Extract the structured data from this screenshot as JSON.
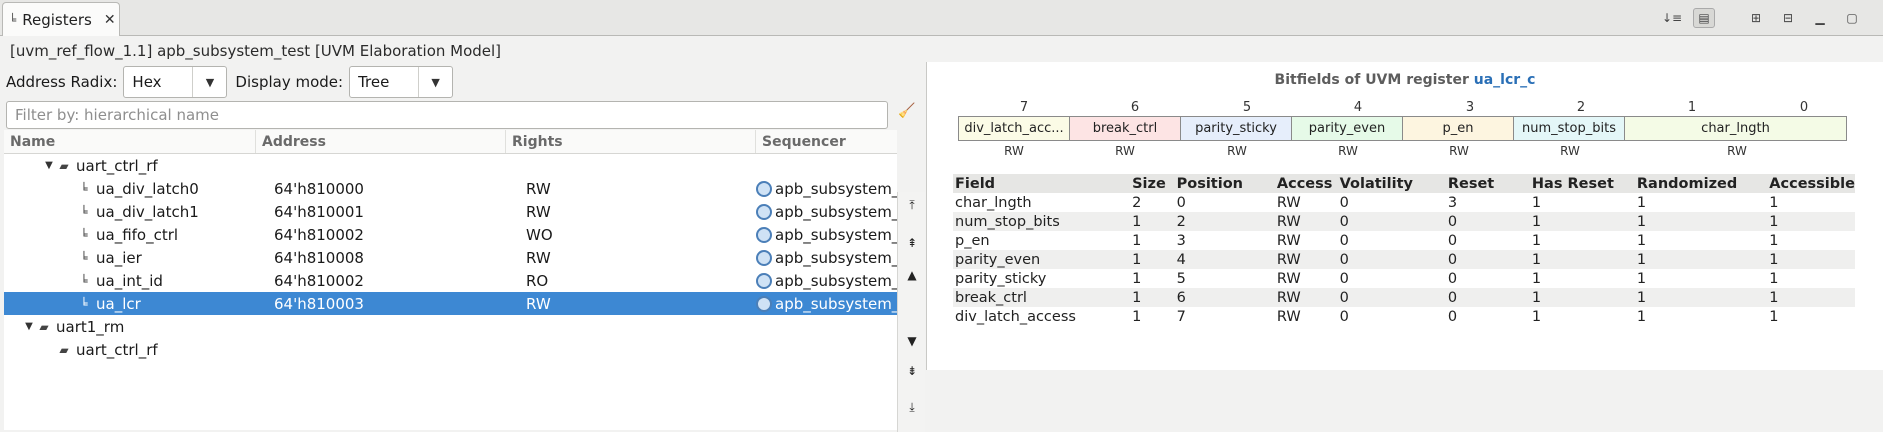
{
  "tab": {
    "title": "Registers",
    "close": "✕"
  },
  "model_line": "[uvm_ref_flow_1.1] apb_subsystem_test [UVM Elaboration Model]",
  "controls": {
    "radix_label": "Address Radix:",
    "radix_value": "Hex",
    "display_label": "Display mode:",
    "display_value": "Tree",
    "filter_placeholder": "Filter by: hierarchical name"
  },
  "columns": [
    "Name",
    "Address",
    "Rights",
    "Sequencer"
  ],
  "rows": [
    {
      "name": "uart_ctrl_rf",
      "address": "",
      "rights": "",
      "sequencer": ""
    },
    {
      "name": "ua_div_latch0",
      "address": "64'h810000",
      "rights": "RW",
      "sequencer": "apb_subsystem_test"
    },
    {
      "name": "ua_div_latch1",
      "address": "64'h810001",
      "rights": "RW",
      "sequencer": "apb_subsystem_test"
    },
    {
      "name": "ua_fifo_ctrl",
      "address": "64'h810002",
      "rights": "WO",
      "sequencer": "apb_subsystem_test"
    },
    {
      "name": "ua_ier",
      "address": "64'h810008",
      "rights": "RW",
      "sequencer": "apb_subsystem_test"
    },
    {
      "name": "ua_int_id",
      "address": "64'h810002",
      "rights": "RO",
      "sequencer": "apb_subsystem_test"
    },
    {
      "name": "ua_lcr",
      "address": "64'h810003",
      "rights": "RW",
      "sequencer": "apb_subsystem_test"
    },
    {
      "name": "uart1_rm",
      "address": "",
      "rights": "",
      "sequencer": ""
    },
    {
      "name": "uart_ctrl_rf",
      "address": "",
      "rights": "",
      "sequencer": ""
    }
  ],
  "bitfields": {
    "title_prefix": "Bitfields of UVM register",
    "register": "ua_lcr_c",
    "bit_numbers": [
      "7",
      "6",
      "5",
      "4",
      "3",
      "2",
      "1",
      "0"
    ],
    "boxes": [
      {
        "label": "div_latch_acc...",
        "access": "RW",
        "color": "#fbfbe6"
      },
      {
        "label": "break_ctrl",
        "access": "RW",
        "color": "#fde4e4"
      },
      {
        "label": "parity_sticky",
        "access": "RW",
        "color": "#e6eefb"
      },
      {
        "label": "parity_even",
        "access": "RW",
        "color": "#e6fae8"
      },
      {
        "label": "p_en",
        "access": "RW",
        "color": "#fdf5e0"
      },
      {
        "label": "num_stop_bits",
        "access": "RW",
        "color": "#e4f7f8"
      },
      {
        "label": "char_lngth",
        "access": "RW",
        "color": "#f4fbe6"
      }
    ]
  },
  "fields_table": {
    "headers": [
      "Field",
      "Size",
      "Position",
      "Access",
      "Volatility",
      "Reset",
      "Has Reset",
      "Randomized",
      "Accessible"
    ],
    "rows": [
      [
        "char_lngth",
        "2",
        "0",
        "RW",
        "0",
        "3",
        "1",
        "1",
        "1"
      ],
      [
        "num_stop_bits",
        "1",
        "2",
        "RW",
        "0",
        "0",
        "1",
        "1",
        "1"
      ],
      [
        "p_en",
        "1",
        "3",
        "RW",
        "0",
        "0",
        "1",
        "1",
        "1"
      ],
      [
        "parity_even",
        "1",
        "4",
        "RW",
        "0",
        "0",
        "1",
        "1",
        "1"
      ],
      [
        "parity_sticky",
        "1",
        "5",
        "RW",
        "0",
        "0",
        "1",
        "1",
        "1"
      ],
      [
        "break_ctrl",
        "1",
        "6",
        "RW",
        "0",
        "0",
        "1",
        "1",
        "1"
      ],
      [
        "div_latch_access",
        "1",
        "7",
        "RW",
        "0",
        "0",
        "1",
        "1",
        "1"
      ]
    ]
  },
  "colors": {
    "selection": "#3d88d3",
    "link": "#2a6fb6"
  }
}
